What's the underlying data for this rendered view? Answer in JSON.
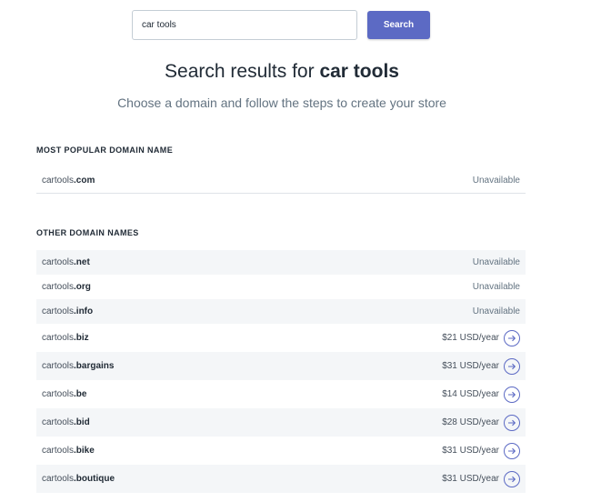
{
  "search": {
    "value": "car tools",
    "button_label": "Search"
  },
  "heading": {
    "prefix": "Search results for ",
    "query": "car tools"
  },
  "subheading": "Choose a domain and follow the steps to create your store",
  "popular": {
    "title": "MOST POPULAR DOMAIN NAME",
    "items": [
      {
        "base": "cartools",
        "tld": ".com",
        "status": "Unavailable"
      }
    ]
  },
  "other": {
    "title": "OTHER DOMAIN NAMES",
    "items": [
      {
        "base": "cartools",
        "tld": ".net",
        "status": "Unavailable"
      },
      {
        "base": "cartools",
        "tld": ".org",
        "status": "Unavailable"
      },
      {
        "base": "cartools",
        "tld": ".info",
        "status": "Unavailable"
      },
      {
        "base": "cartools",
        "tld": ".biz",
        "price": "$21 USD/year"
      },
      {
        "base": "cartools",
        "tld": ".bargains",
        "price": "$31 USD/year"
      },
      {
        "base": "cartools",
        "tld": ".be",
        "price": "$14 USD/year"
      },
      {
        "base": "cartools",
        "tld": ".bid",
        "price": "$28 USD/year"
      },
      {
        "base": "cartools",
        "tld": ".bike",
        "price": "$31 USD/year"
      },
      {
        "base": "cartools",
        "tld": ".boutique",
        "price": "$31 USD/year"
      }
    ]
  },
  "colors": {
    "accent": "#5c6ac4",
    "row_shade": "#f4f6f8",
    "text": "#212b36",
    "muted": "#637381"
  }
}
